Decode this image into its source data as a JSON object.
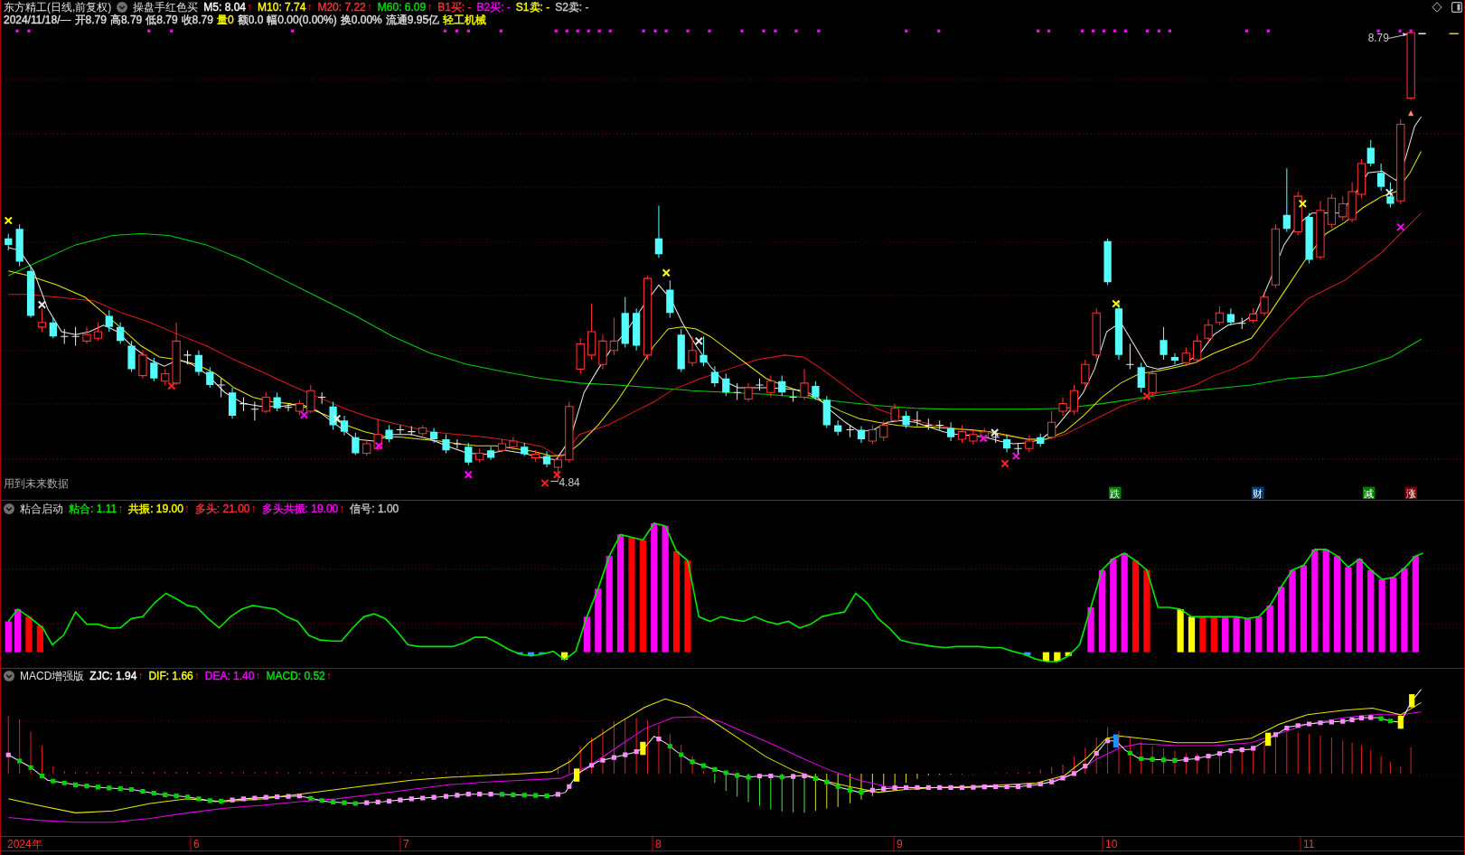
{
  "main_chart": {
    "title": "东方精工(日线,前复权)",
    "indicator": "操盘手红色买",
    "legend": [
      {
        "text": "M5: 8.04",
        "arrow": "↑",
        "color": "#ffffff"
      },
      {
        "text": "M10: 7.74",
        "arrow": "↑",
        "color": "#ffff00"
      },
      {
        "text": "M20: 7.22",
        "arrow": "↑",
        "color": "#ff3232"
      },
      {
        "text": "M60: 6.09",
        "arrow": "↑",
        "color": "#00e600"
      },
      {
        "text": "B1买: -",
        "color": "#ff3232"
      },
      {
        "text": "B2买: -",
        "color": "#ff00ff"
      },
      {
        "text": "S1卖: -",
        "color": "#ffff00"
      },
      {
        "text": "S2卖: -",
        "color": "#c8c8c8"
      }
    ],
    "quote": [
      {
        "text": "2024/11/18/—",
        "color": "#e0e0e0"
      },
      {
        "text": "开8.79",
        "color": "#e0e0e0"
      },
      {
        "text": "高8.79",
        "color": "#e0e0e0"
      },
      {
        "text": "低8.79",
        "color": "#e0e0e0"
      },
      {
        "text": "收8.79",
        "color": "#e0e0e0"
      },
      {
        "text": "量0",
        "color": "#ffff00"
      },
      {
        "text": "额0.0",
        "color": "#e0e0e0"
      },
      {
        "text": "幅0.00(0.00%)",
        "color": "#e0e0e0"
      },
      {
        "text": "换0.00%",
        "color": "#e0e0e0"
      },
      {
        "text": "流通9.95亿",
        "color": "#e0e0e0"
      },
      {
        "text": "轻工机械",
        "color": "#ffff00"
      }
    ],
    "high_label": "8.79",
    "low_label": "4.84",
    "notice": "用到未来数据",
    "signals": [
      {
        "text": "跌",
        "color": "#008000"
      },
      {
        "text": "财",
        "color": "#003f7f"
      },
      {
        "text": "减",
        "color": "#008000"
      },
      {
        "text": "涨",
        "color": "#800000"
      }
    ]
  },
  "adhesion_panel": {
    "title": "粘合启动",
    "legend": [
      {
        "text": "粘合: 1.11",
        "arrow": "↑",
        "color": "#00e600"
      },
      {
        "text": "共振: 19.00",
        "arrow": "↑",
        "color": "#ffff00"
      },
      {
        "text": "多头: 21.00",
        "arrow": "↑",
        "color": "#ff3232"
      },
      {
        "text": "多头共振: 19.00",
        "arrow": "↑",
        "color": "#ff00ff"
      },
      {
        "text": "信号: 1.00",
        "color": "#c8c8c8"
      }
    ]
  },
  "macd_panel": {
    "title": "MACD增强版",
    "legend": [
      {
        "text": "ZJC: 1.94",
        "arrow": "↑",
        "color": "#ffffff"
      },
      {
        "text": "DIF: 1.66",
        "arrow": "↑",
        "color": "#ffff00"
      },
      {
        "text": "DEA: 1.40",
        "arrow": "↑",
        "color": "#ff00ff"
      },
      {
        "text": "MACD: 0.52",
        "arrow": "↑",
        "color": "#00e600"
      }
    ]
  },
  "time_axis": {
    "labels": [
      "2024年",
      "6",
      "7",
      "8",
      "9",
      "10",
      "11"
    ]
  }
}
